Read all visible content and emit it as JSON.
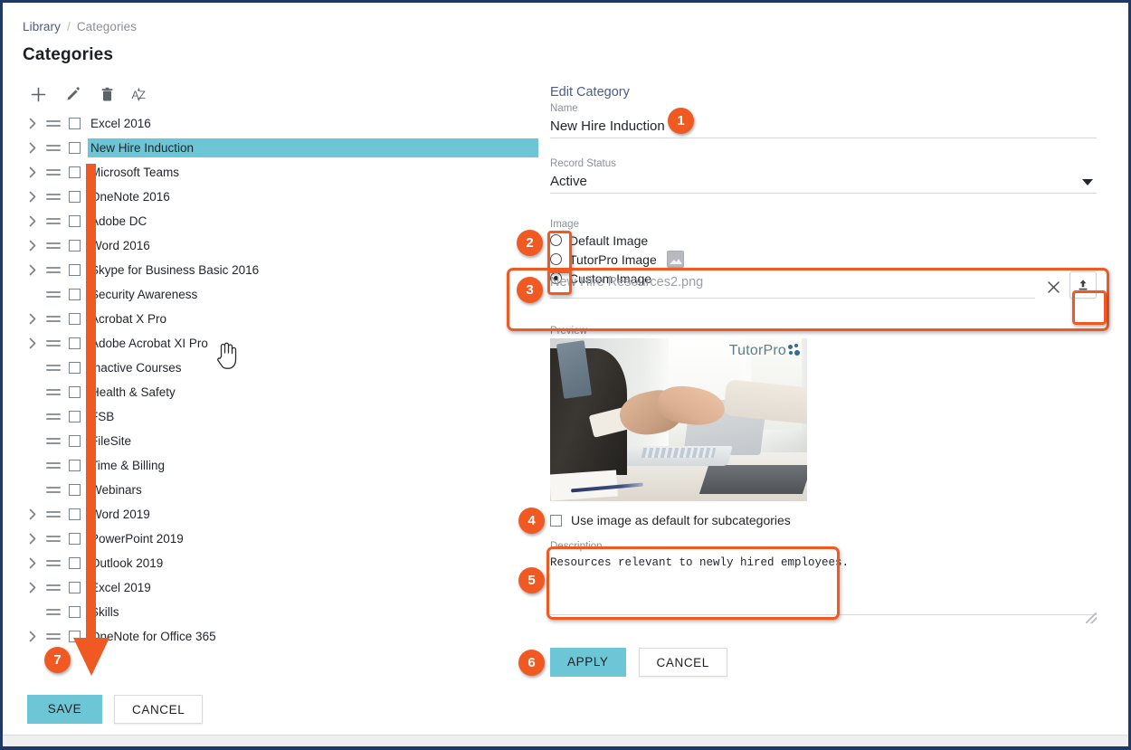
{
  "breadcrumb": {
    "root": "Library",
    "separator": "/",
    "current": "Categories"
  },
  "page_title": "Categories",
  "left_panel": {
    "toolbar": [
      {
        "name": "add-icon",
        "label": "Add"
      },
      {
        "name": "edit-pencil-icon",
        "label": "Edit"
      },
      {
        "name": "delete-trash-icon",
        "label": "Delete"
      },
      {
        "name": "sort-az-icon",
        "label": "Sort A-Z"
      }
    ],
    "tree_items": [
      {
        "label": "Excel 2016",
        "expandable": true,
        "selected": false
      },
      {
        "label": "New Hire Induction",
        "expandable": true,
        "selected": true
      },
      {
        "label": "Microsoft Teams",
        "expandable": true,
        "selected": false
      },
      {
        "label": "OneNote 2016",
        "expandable": true,
        "selected": false
      },
      {
        "label": "Adobe DC",
        "expandable": true,
        "selected": false
      },
      {
        "label": "Word 2016",
        "expandable": true,
        "selected": false
      },
      {
        "label": "Skype for Business Basic 2016",
        "expandable": true,
        "selected": false
      },
      {
        "label": "Security Awareness",
        "expandable": false,
        "selected": false
      },
      {
        "label": "Acrobat X Pro",
        "expandable": true,
        "selected": false
      },
      {
        "label": "Adobe Acrobat XI Pro",
        "expandable": true,
        "selected": false
      },
      {
        "label": "Inactive Courses",
        "expandable": false,
        "selected": false
      },
      {
        "label": "Health & Safety",
        "expandable": false,
        "selected": false
      },
      {
        "label": "FSB",
        "expandable": false,
        "selected": false
      },
      {
        "label": "FileSite",
        "expandable": false,
        "selected": false
      },
      {
        "label": "Time & Billing",
        "expandable": false,
        "selected": false
      },
      {
        "label": "Webinars",
        "expandable": false,
        "selected": false
      },
      {
        "label": "Word 2019",
        "expandable": true,
        "selected": false
      },
      {
        "label": "PowerPoint 2019",
        "expandable": true,
        "selected": false
      },
      {
        "label": "Outlook 2019",
        "expandable": true,
        "selected": false
      },
      {
        "label": "Excel 2019",
        "expandable": true,
        "selected": false
      },
      {
        "label": "Skills",
        "expandable": false,
        "selected": false
      },
      {
        "label": "OneNote for Office 365",
        "expandable": true,
        "selected": false
      }
    ],
    "save_label": "SAVE",
    "cancel_label": "CANCEL"
  },
  "right_panel": {
    "heading": "Edit Category",
    "name": {
      "label": "Name",
      "value": "New Hire Induction"
    },
    "record_status": {
      "label": "Record Status",
      "value": "Active"
    },
    "image": {
      "label": "Image",
      "options": [
        {
          "label": "Default Image",
          "selected": false
        },
        {
          "label": "TutorPro Image",
          "selected": false
        },
        {
          "label": "Custom Image",
          "selected": true
        }
      ],
      "file_value": "New Hire Resources2.png",
      "clear_icon": "close-x-icon",
      "upload_icon": "upload-icon"
    },
    "preview": {
      "label": "Preview",
      "watermark": "TutorPro"
    },
    "default_for_subcategories": {
      "label": "Use image as default for subcategories",
      "checked": false
    },
    "description": {
      "label": "Description",
      "value": "Resources relevant to newly hired employees."
    },
    "apply_label": "APPLY",
    "cancel_label": "CANCEL"
  },
  "annotations": {
    "badges": [
      {
        "num": "1"
      },
      {
        "num": "2"
      },
      {
        "num": "3"
      },
      {
        "num": "4"
      },
      {
        "num": "5"
      },
      {
        "num": "6"
      },
      {
        "num": "7"
      }
    ]
  },
  "colors": {
    "accent_teal": "#6dc6d6",
    "annotation_orange": "#f05a22",
    "frame_navy": "#1f3864",
    "link_blue": "#4a5d8a"
  }
}
